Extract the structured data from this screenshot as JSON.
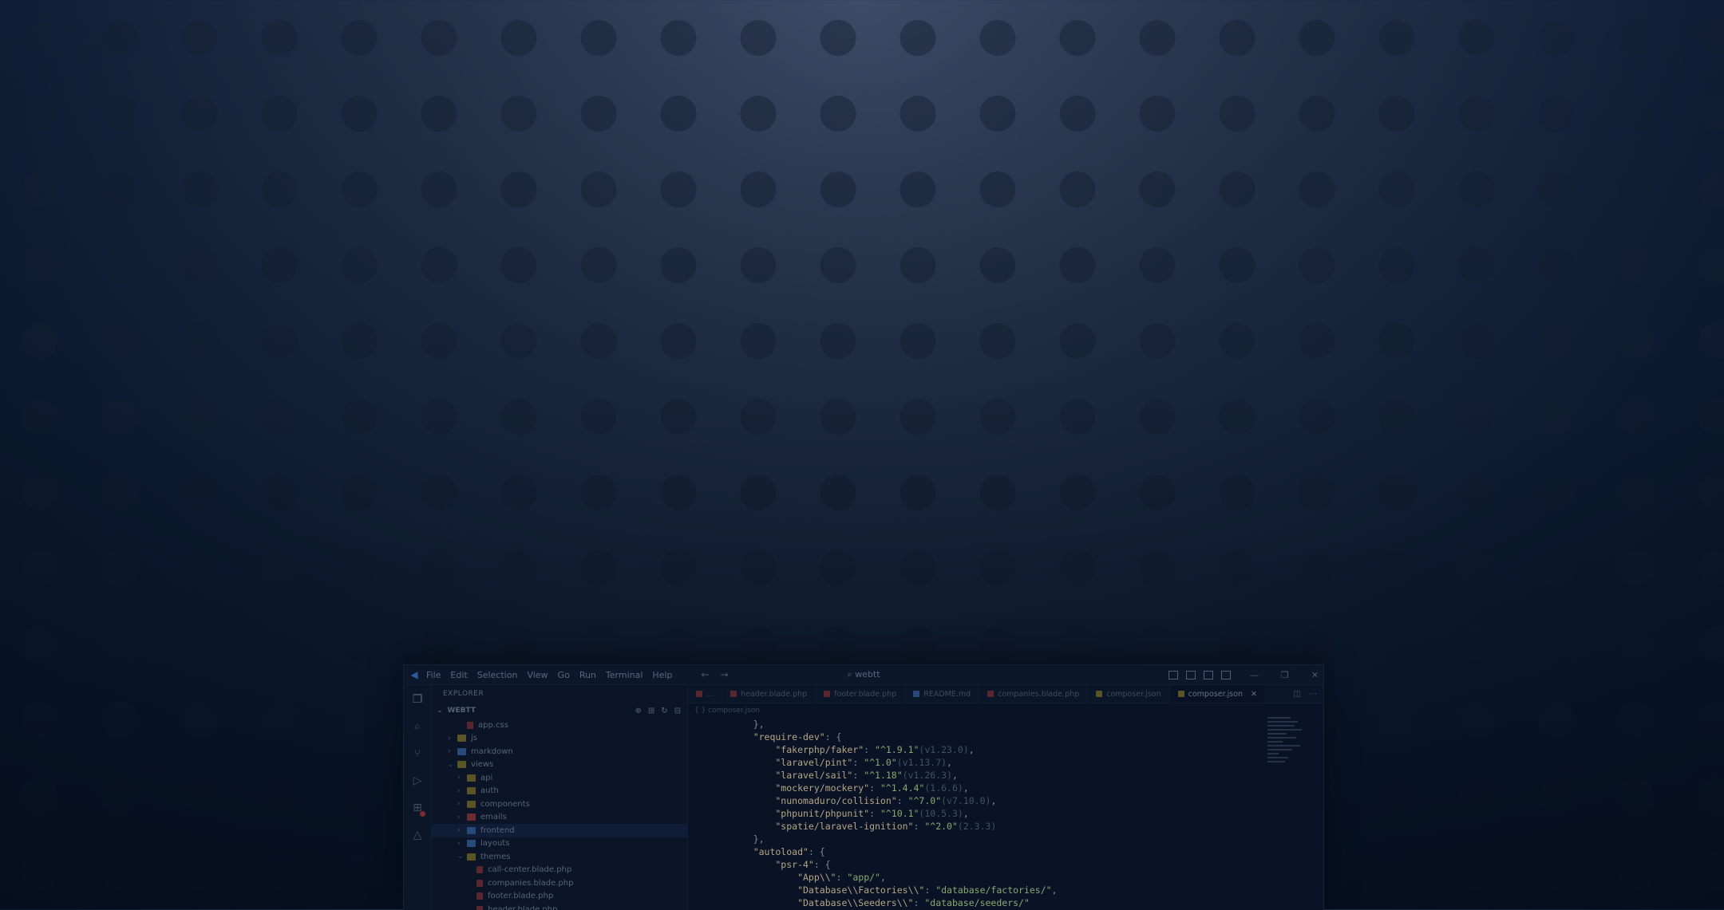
{
  "window": {
    "title": "webtt",
    "menu": [
      "File",
      "Edit",
      "Selection",
      "View",
      "Go",
      "Run",
      "Terminal",
      "Help"
    ]
  },
  "sidebar": {
    "header": "EXPLORER",
    "project": "WEBTT",
    "tree": [
      {
        "label": "app.css",
        "type": "file",
        "depth": 2
      },
      {
        "label": "js",
        "type": "folder",
        "depth": 1,
        "color": "yellow"
      },
      {
        "label": "markdown",
        "type": "folder",
        "depth": 1,
        "color": "blue"
      },
      {
        "label": "views",
        "type": "folder-open",
        "depth": 1,
        "color": "yellow"
      },
      {
        "label": "api",
        "type": "folder",
        "depth": 2,
        "color": "yellow"
      },
      {
        "label": "auth",
        "type": "folder",
        "depth": 2,
        "color": "yellow"
      },
      {
        "label": "components",
        "type": "folder",
        "depth": 2,
        "color": "yellow"
      },
      {
        "label": "emails",
        "type": "folder",
        "depth": 2,
        "color": "red"
      },
      {
        "label": "frontend",
        "type": "folder",
        "depth": 2,
        "color": "blue",
        "selected": true
      },
      {
        "label": "layouts",
        "type": "folder",
        "depth": 2,
        "color": "blue"
      },
      {
        "label": "themes",
        "type": "folder-open",
        "depth": 2,
        "color": "yellow"
      },
      {
        "label": "call-center.blade.php",
        "type": "file",
        "depth": 3
      },
      {
        "label": "companies.blade.php",
        "type": "file",
        "depth": 3
      },
      {
        "label": "footer.blade.php",
        "type": "file",
        "depth": 3
      },
      {
        "label": "header.blade.php",
        "type": "file",
        "depth": 3
      }
    ]
  },
  "tabs": [
    {
      "label": "...",
      "kind": "php"
    },
    {
      "label": "header.blade.php",
      "kind": "php"
    },
    {
      "label": "footer.blade.php",
      "kind": "php"
    },
    {
      "label": "README.md",
      "kind": "md"
    },
    {
      "label": "companies.blade.php",
      "kind": "php"
    },
    {
      "label": "composer.json",
      "kind": "json"
    },
    {
      "label": "composer.json",
      "kind": "json",
      "active": true
    }
  ],
  "editor": {
    "breadcrumb": "{ } composer.json",
    "lines": [
      {
        "n": "",
        "parts": [
          [
            "p",
            "    },"
          ]
        ]
      },
      {
        "n": "",
        "parts": [
          [
            "k",
            "    \"require-dev\""
          ],
          [
            "p",
            ": {"
          ]
        ]
      },
      {
        "n": "",
        "parts": [
          [
            "k",
            "        \"fakerphp/faker\""
          ],
          [
            "p",
            ": "
          ],
          [
            "s",
            "\"^1.9.1\""
          ],
          [
            "cm",
            "(v1.23.0)"
          ],
          [
            "p",
            ","
          ]
        ]
      },
      {
        "n": "",
        "parts": [
          [
            "k",
            "        \"laravel/pint\""
          ],
          [
            "p",
            ": "
          ],
          [
            "s",
            "\"^1.0\""
          ],
          [
            "cm",
            "(v1.13.7)"
          ],
          [
            "p",
            ","
          ]
        ]
      },
      {
        "n": "",
        "parts": [
          [
            "k",
            "        \"laravel/sail\""
          ],
          [
            "p",
            ": "
          ],
          [
            "s",
            "\"^1.18\""
          ],
          [
            "cm",
            "(v1.26.3)"
          ],
          [
            "p",
            ","
          ]
        ]
      },
      {
        "n": "",
        "parts": [
          [
            "k",
            "        \"mockery/mockery\""
          ],
          [
            "p",
            ": "
          ],
          [
            "s",
            "\"^1.4.4\""
          ],
          [
            "cm",
            "(1.6.6)"
          ],
          [
            "p",
            ","
          ]
        ]
      },
      {
        "n": "",
        "parts": [
          [
            "k",
            "        \"nunomaduro/collision\""
          ],
          [
            "p",
            ": "
          ],
          [
            "s",
            "\"^7.0\""
          ],
          [
            "cm",
            "(v7.10.0)"
          ],
          [
            "p",
            ","
          ]
        ]
      },
      {
        "n": "",
        "parts": [
          [
            "k",
            "        \"phpunit/phpunit\""
          ],
          [
            "p",
            ": "
          ],
          [
            "s",
            "\"^10.1\""
          ],
          [
            "cm",
            "(10.5.3)"
          ],
          [
            "p",
            ","
          ]
        ]
      },
      {
        "n": "",
        "parts": [
          [
            "k",
            "        \"spatie/laravel-ignition\""
          ],
          [
            "p",
            ": "
          ],
          [
            "s",
            "\"^2.0\""
          ],
          [
            "cm",
            "(2.3.3)"
          ]
        ]
      },
      {
        "n": "",
        "parts": [
          [
            "p",
            "    },"
          ]
        ]
      },
      {
        "n": "",
        "parts": [
          [
            "k",
            "    \"autoload\""
          ],
          [
            "p",
            ": {"
          ]
        ]
      },
      {
        "n": "",
        "parts": [
          [
            "k",
            "        \"psr-4\""
          ],
          [
            "p",
            ": {"
          ]
        ]
      },
      {
        "n": "",
        "parts": [
          [
            "k",
            "            \"App\\\\\""
          ],
          [
            "p",
            ": "
          ],
          [
            "s",
            "\"app/\""
          ],
          [
            "p",
            ","
          ]
        ]
      },
      {
        "n": "",
        "parts": [
          [
            "k",
            "            \"Database\\\\Factories\\\\\""
          ],
          [
            "p",
            ": "
          ],
          [
            "s",
            "\"database/factories/\""
          ],
          [
            "p",
            ","
          ]
        ]
      },
      {
        "n": "",
        "parts": [
          [
            "k",
            "            \"Database\\\\Seeders\\\\\""
          ],
          [
            "p",
            ": "
          ],
          [
            "s",
            "\"database/seeders/\""
          ]
        ]
      }
    ]
  },
  "colors": {
    "background": "#0e1e36",
    "window": "#0a1426",
    "key": "#b6a585",
    "string": "#8aa872"
  }
}
